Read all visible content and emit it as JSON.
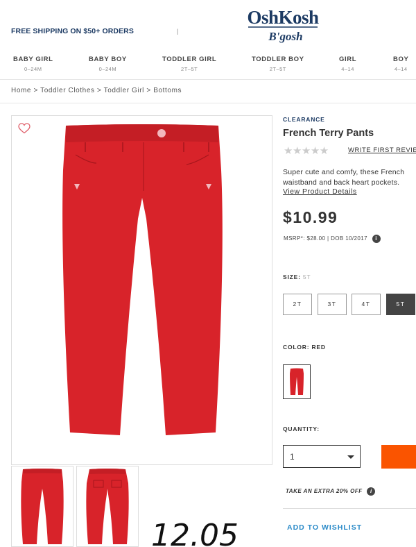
{
  "header": {
    "promo": "FREE SHIPPING ON $50+ ORDERS",
    "divider": "|",
    "logo_top": "OshKosh",
    "logo_bottom": "B'gosh"
  },
  "nav": [
    {
      "label": "BABY GIRL",
      "sub": "0–24M"
    },
    {
      "label": "BABY BOY",
      "sub": "0–24M"
    },
    {
      "label": "TODDLER GIRL",
      "sub": "2T–5T"
    },
    {
      "label": "TODDLER BOY",
      "sub": "2T–5T"
    },
    {
      "label": "GIRL",
      "sub": "4–14"
    },
    {
      "label": "BOY",
      "sub": "4–14"
    }
  ],
  "breadcrumb": [
    "Home",
    "Toddler Clothes",
    "Toddler Girl",
    "Bottoms"
  ],
  "breadcrumb_sep": ">",
  "product": {
    "badge": "CLEARANCE",
    "title": "French Terry Pants",
    "rating_stars": "★★★★★",
    "review_link": "WRITE FIRST REVIEW",
    "desc_line1": "Super cute and comfy, these French",
    "desc_line2": "waistband and back heart pockets.",
    "details_link": "View Product Details",
    "price": "$10.99",
    "msrp": "MSRP*: $28.00  |  DOB 10/2017",
    "info_icon": "i",
    "garment_color": "#d8232a"
  },
  "size": {
    "label": "SIZE: ",
    "selected": "5T",
    "options": [
      "2T",
      "3T",
      "4T",
      "5T"
    ]
  },
  "color": {
    "label": "COLOR: RED"
  },
  "quantity": {
    "label": "QUANTITY:",
    "value": "1",
    "cart_color": "#fa5400"
  },
  "promo_extra": "TAKE AN EXTRA 20% OFF",
  "wishlist": "ADD TO WISHLIST",
  "handwritten": "12.05"
}
